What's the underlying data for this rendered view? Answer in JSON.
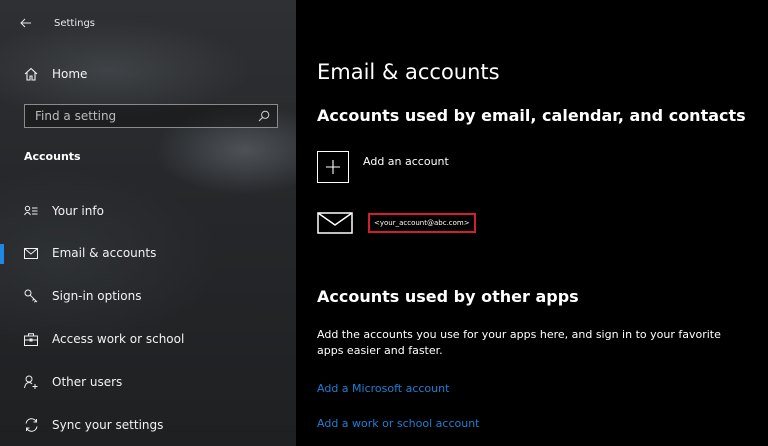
{
  "window": {
    "title": "Settings",
    "back_icon": "back-arrow-icon"
  },
  "sidebar": {
    "home": {
      "label": "Home",
      "icon": "home-icon"
    },
    "search": {
      "placeholder": "Find a setting",
      "value": "",
      "icon": "search-icon"
    },
    "section_label": "Accounts",
    "items": [
      {
        "label": "Your info",
        "icon": "person-list-icon",
        "selected": false
      },
      {
        "label": "Email & accounts",
        "icon": "envelope-icon",
        "selected": true
      },
      {
        "label": "Sign-in options",
        "icon": "key-icon",
        "selected": false
      },
      {
        "label": "Access work or school",
        "icon": "briefcase-icon",
        "selected": false
      },
      {
        "label": "Other users",
        "icon": "add-person-icon",
        "selected": false
      },
      {
        "label": "Sync your settings",
        "icon": "sync-icon",
        "selected": false
      }
    ],
    "accent_color": "#1f88e5"
  },
  "main": {
    "title": "Email & accounts",
    "email_section": {
      "heading": "Accounts used by email, calendar, and contacts",
      "add_account_label": "Add an account",
      "add_account_icon": "plus-icon",
      "account_icon": "mail-icon",
      "account_email": "<your_account@abc.com>",
      "highlight_color": "#d1202b"
    },
    "other_apps_section": {
      "heading": "Accounts used by other apps",
      "description": "Add the accounts you use for your apps here, and sign in to your favorite apps easier and faster.",
      "links": [
        {
          "label": "Add a Microsoft account"
        },
        {
          "label": "Add a work or school account"
        }
      ],
      "link_color": "#1d7fd6"
    }
  }
}
